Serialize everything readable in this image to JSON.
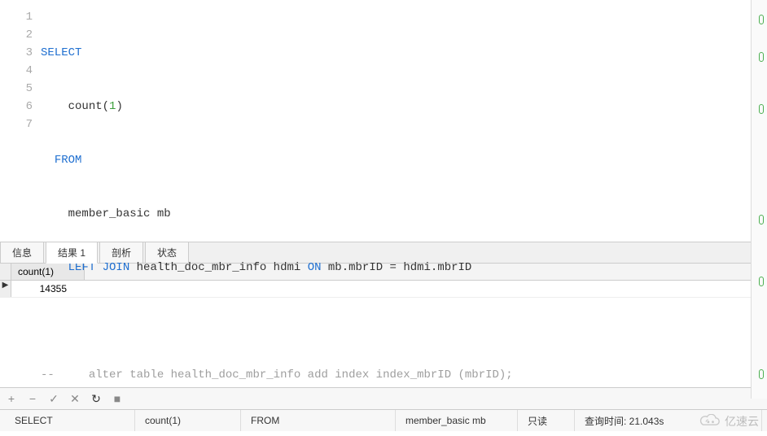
{
  "editor": {
    "line_numbers": [
      "1",
      "2",
      "3",
      "4",
      "5",
      "6",
      "7"
    ],
    "l1_kw": "SELECT",
    "l2_fn": "count",
    "l2_paren_open": "(",
    "l2_arg": "1",
    "l2_paren_close": ")",
    "l3_kw": "FROM",
    "l4_txt": "member_basic mb",
    "l5_kw1": "LEFT",
    "l5_kw2": "JOIN",
    "l5_tbl": "health_doc_mbr_info hdmi",
    "l5_kw3": "ON",
    "l5_cond": "mb.mbrID = hdmi.mbrID",
    "l7_prefix": "-- ",
    "l7_cmt": "alter table health_doc_mbr_info add index index_mbrID (mbrID);"
  },
  "tabs": {
    "info": "信息",
    "result": "结果 1",
    "profile": "剖析",
    "status": "状态"
  },
  "results": {
    "header": "count(1)",
    "row1": "14355"
  },
  "toolbar": {
    "plus": "+",
    "minus": "−",
    "check": "✓",
    "cross": "✕",
    "refresh": "↻",
    "stop": "■"
  },
  "statusbar": {
    "c1": "SELECT",
    "c2": "count(1)",
    "c3": "FROM",
    "c4": "member_basic mb",
    "c5": "只读",
    "c6": "查询时间: 21.043s"
  },
  "watermark": "亿速云"
}
